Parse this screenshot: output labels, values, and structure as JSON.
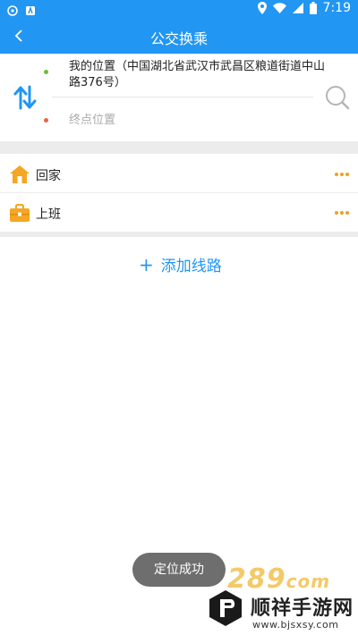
{
  "status_bar": {
    "time": "7:19",
    "icons": [
      "app-icon",
      "store-icon",
      "location-icon",
      "wifi-icon",
      "signal-icon",
      "battery-icon"
    ]
  },
  "app_bar": {
    "title": "公交换乘",
    "back_icon": "chevron-left-icon"
  },
  "route": {
    "start_text": "我的位置（中国湖北省武汉市武昌区粮道街道中山路376号）",
    "end_placeholder": "终点位置",
    "start_dot_color": "#6abf3c",
    "end_dot_color": "#e5683c",
    "swap_icon": "swap-vertical-icon",
    "search_icon": "search-icon"
  },
  "favorites": [
    {
      "label": "回家",
      "icon": "home-icon",
      "more_icon": "more-horizontal-icon"
    },
    {
      "label": "上班",
      "icon": "briefcase-icon",
      "more_icon": "more-horizontal-icon"
    }
  ],
  "add_route": {
    "label": "添加线路",
    "icon": "plus-icon"
  },
  "toast": {
    "text": "定位成功"
  },
  "watermark": {
    "number": "289",
    "suffix": "com",
    "brand": "顺祥手游网",
    "url": "www.bjsxsy.com"
  },
  "colors": {
    "primary": "#2196f3",
    "accent_orange": "#f0a020",
    "separator": "#ececec"
  }
}
